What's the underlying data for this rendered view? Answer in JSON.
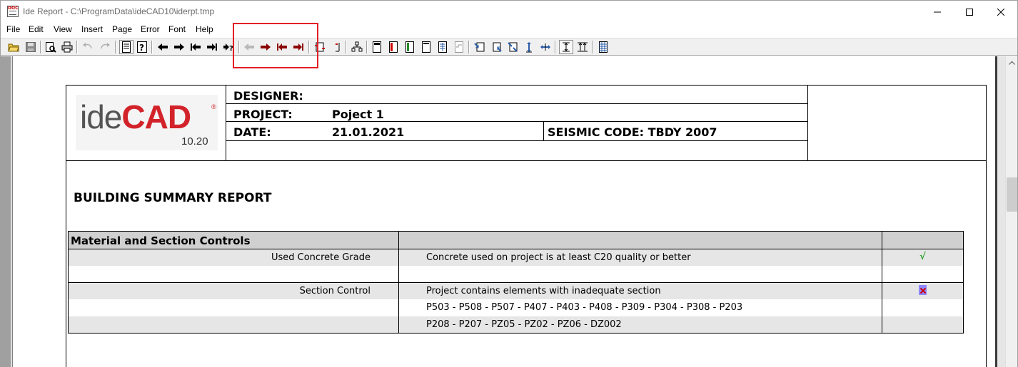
{
  "window": {
    "title": "Ide Report - C:\\ProgramData\\ideCAD10\\iderpt.tmp",
    "app_icon_text": "DOC"
  },
  "menu": [
    "File",
    "Edit",
    "View",
    "Insert",
    "Page",
    "Error",
    "Font",
    "Help"
  ],
  "toolbar": {
    "highlight_color": "#e31e24",
    "buttons": [
      "open-folder-icon",
      "save-icon",
      "print-preview-icon",
      "print-icon",
      "undo-icon",
      "redo-icon",
      "page-view-icon",
      "context-help-icon",
      "arrow-left-icon",
      "arrow-right-icon",
      "first-icon",
      "last-icon",
      "goto-icon",
      "prev-error-icon",
      "next-error-icon",
      "first-error-icon",
      "last-error-icon",
      "refresh-icon",
      "page-end-icon",
      "tree-icon",
      "layout-1-icon",
      "layout-2-icon",
      "layout-3-icon",
      "layout-4-icon",
      "layout-5-icon",
      "layout-6-icon",
      "zoom-1-icon",
      "zoom-2-icon",
      "zoom-3-icon",
      "fit-height-icon",
      "fit-width-icon",
      "single-page-icon",
      "multi-page-icon",
      "columns-icon"
    ]
  },
  "logo": {
    "ide": "ide",
    "cad": "CAD",
    "reg": "®",
    "version": "10.20",
    "brand_color": "#d3232a"
  },
  "header": {
    "designer_label": "DESIGNER:",
    "project_label": "PROJECT:",
    "project_value": "Poject 1",
    "date_label": "DATE:",
    "date_value": "21.01.2021",
    "seismic": "SEISMIC CODE: TBDY 2007"
  },
  "report_title": "BUILDING SUMMARY REPORT",
  "controls": {
    "heading": "Material and Section Controls",
    "rows": [
      {
        "name": "Used Concrete Grade",
        "text": "Concrete used on project is at least C20 quality or better",
        "status": "√",
        "status_color": "#2ca02c"
      },
      {
        "name": "Section Control",
        "text": "Project contains elements with inadequate section",
        "status": "fail"
      }
    ],
    "element_lines": [
      "P503 - P508 - P507 - P407 - P403 - P408 - P309 - P304 - P308 - P203",
      "P208 - P207 - PZ05 - PZ02 - PZ06 - DZ002"
    ]
  }
}
